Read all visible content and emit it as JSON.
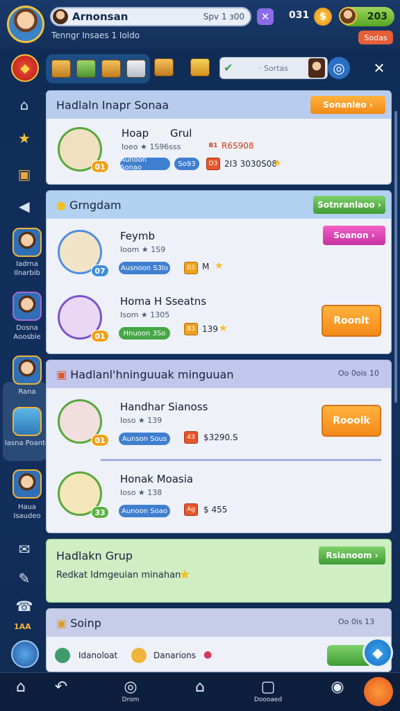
{
  "header": {
    "player_name": "Arnonsan",
    "level": "Sрv 1 з00",
    "subtitle": "Tenngr Insaes 1 Ioldo",
    "coins": "031",
    "gems": "203",
    "red_button": "Sodas"
  },
  "toolbar": {
    "search_placeholder": "· Sortas"
  },
  "sidebar": {
    "item1_label": "Iadrna Ilnarbib",
    "item2_label": "Dosna Aoosble",
    "item3_label": "Rana",
    "item4_label": "Iasna Poante",
    "item5_label": "Haua Isaudeo",
    "count": "1AA"
  },
  "card1": {
    "title": "Hadlaln Inapr Sonaa",
    "button": "Sonanleo",
    "row": {
      "title": "Hoap",
      "title2": "Grul",
      "sub": "Ioeo ★ 1S96sss",
      "pill1": "Aunoon Sonao",
      "pill2": "So93",
      "badge": "01",
      "val1": "R6S908",
      "val2": "2I3 3030S08",
      "rb1": "B1",
      "rb2": "D3"
    }
  },
  "card2": {
    "title": "Grngdam",
    "button": "Sotnranlaoo",
    "row1": {
      "title": "Feymb",
      "sub": "Ioom ★ 1S9",
      "pill": "Ausnoon S3lo",
      "badge": "07",
      "val": "M",
      "rb": "03",
      "button": "Soanon"
    },
    "row2": {
      "title": "Homa H Sseatns",
      "sub": "Isom ★ 1305",
      "pill": "Hnuoon 3So",
      "badge": "01",
      "val": "139",
      "rb": "B3",
      "button": "Roonlt"
    }
  },
  "card3": {
    "title": "Hadlanl'hninguuak minguuan",
    "right": "Oo 0ois 10",
    "row1": {
      "title": "Handhar Sianoss",
      "sub": "Ioso ★ 139",
      "pill": "Aunson Sous",
      "badge": "01",
      "rb": "43",
      "val": "$3290.S",
      "button": "Rooolk"
    },
    "row2": {
      "title": "Honak Moasia",
      "sub": "Ioso ★ 138",
      "pill": "Aunoon Soao",
      "badge": "33",
      "rb": "Ag",
      "val": "$ 455"
    }
  },
  "card4": {
    "title": "Hadlakn Grup",
    "desc": "Redkat Idmgeuian minahan",
    "button": "Rsianoom"
  },
  "card5": {
    "title": "Soinp",
    "right": "Oo 0is 13",
    "item1": "Idanoloat",
    "item2": "Danarions"
  },
  "bottom_nav": {
    "item2": "Drom",
    "item4": "Doooaed"
  }
}
